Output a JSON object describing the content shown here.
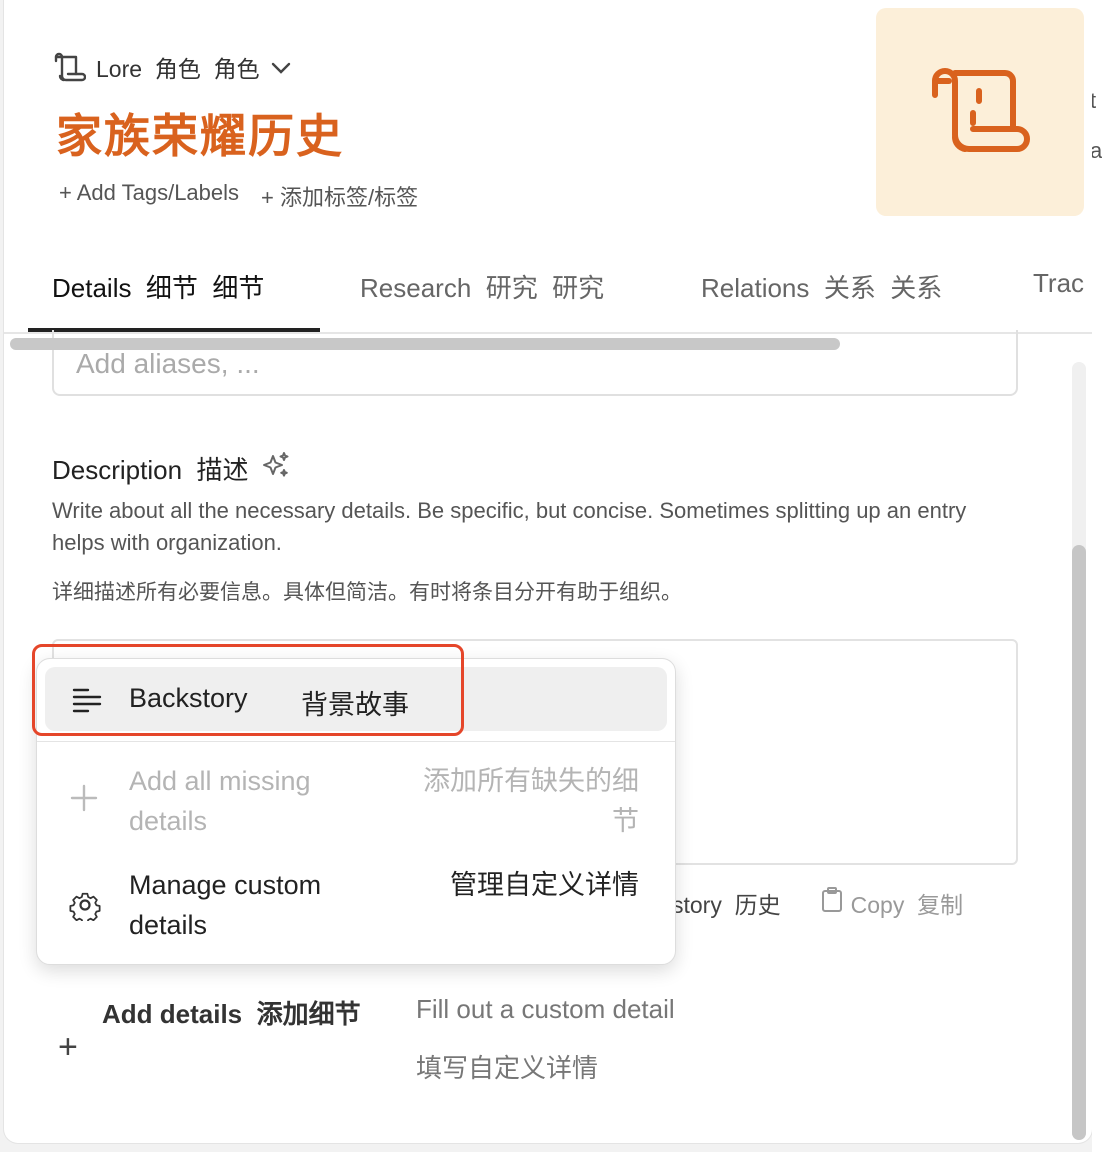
{
  "header": {
    "breadcrumb": "Lore  角色  角色",
    "title": "家族荣耀历史",
    "add_tags": "+ Add Tags/Labels",
    "add_tags_zh": "+ 添加标签/标签",
    "accent_color": "#d9621e",
    "cover_bg": "#fcefd9"
  },
  "tabs": [
    {
      "label": "Details  细节  细节",
      "active": true
    },
    {
      "label": "Research  研究  研究",
      "active": false
    },
    {
      "label": "Relations  关系  关系",
      "active": false
    },
    {
      "label": "Trac",
      "active": false
    }
  ],
  "aliases": {
    "placeholder": "Add aliases, ..."
  },
  "description": {
    "heading": "Description  描述",
    "sub_en": "Write about all the necessary details. Be specific, but concise. Sometimes splitting up an entry helps with organization.",
    "sub_zh": "详细描述所有必要信息。具体但简洁。有时将条目分开有助于组织。"
  },
  "editor_actions": {
    "history": "story  历史",
    "copy": "Copy  复制"
  },
  "add_details": {
    "label": "Add details  添加细节",
    "hint_en": "Fill out a custom detail",
    "hint_zh": "填写自定义详情"
  },
  "menu": {
    "backstory_en": "Backstory",
    "backstory_zh": "背景故事",
    "missing_en": "Add all missing details",
    "missing_zh": "添加所有缺失的细节",
    "manage_en": "Manage custom details",
    "manage_zh": "管理自定义详情"
  },
  "right_edge": {
    "char1": "t",
    "char2": "a"
  }
}
